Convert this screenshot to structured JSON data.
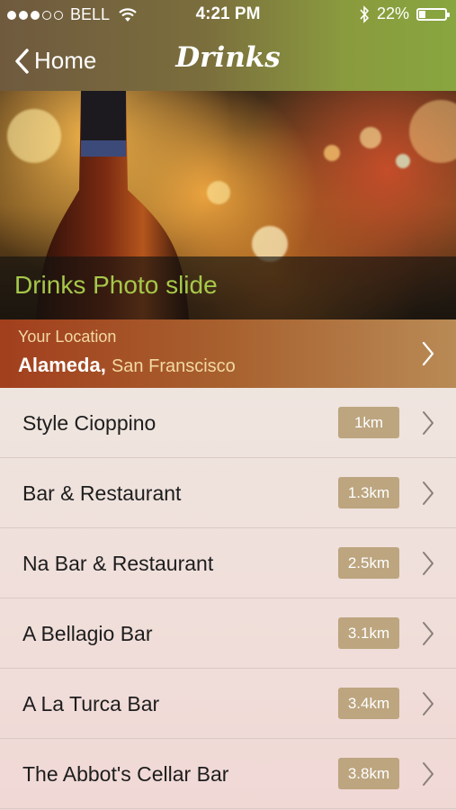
{
  "status_bar": {
    "carrier": "BELL",
    "time": "4:21 PM",
    "battery": "22%",
    "battery_level": 0.22,
    "signal_bars_filled": 3,
    "signal_bars_total": 5,
    "icons": [
      "wifi-icon",
      "bluetooth-icon",
      "battery-icon"
    ]
  },
  "nav": {
    "back_label": "Home",
    "title": "Drinks"
  },
  "hero": {
    "caption": "Drinks Photo slide"
  },
  "location": {
    "label": "Your Location",
    "city": "Alameda,",
    "region": "San Franscisco"
  },
  "list": {
    "items": [
      {
        "name": "Style Cioppino",
        "distance": "1km"
      },
      {
        "name": "Bar & Restaurant",
        "distance": "1.3km"
      },
      {
        "name": "Na Bar & Restaurant",
        "distance": "2.5km"
      },
      {
        "name": "A Bellagio Bar",
        "distance": "3.1km"
      },
      {
        "name": "A La Turca Bar",
        "distance": "3.4km"
      },
      {
        "name": "The Abbot's Cellar Bar",
        "distance": "3.8km"
      }
    ]
  },
  "colors": {
    "accent_green": "#a6c84a",
    "location_bar": "#a8612f",
    "distance_badge": "#bca57f"
  }
}
